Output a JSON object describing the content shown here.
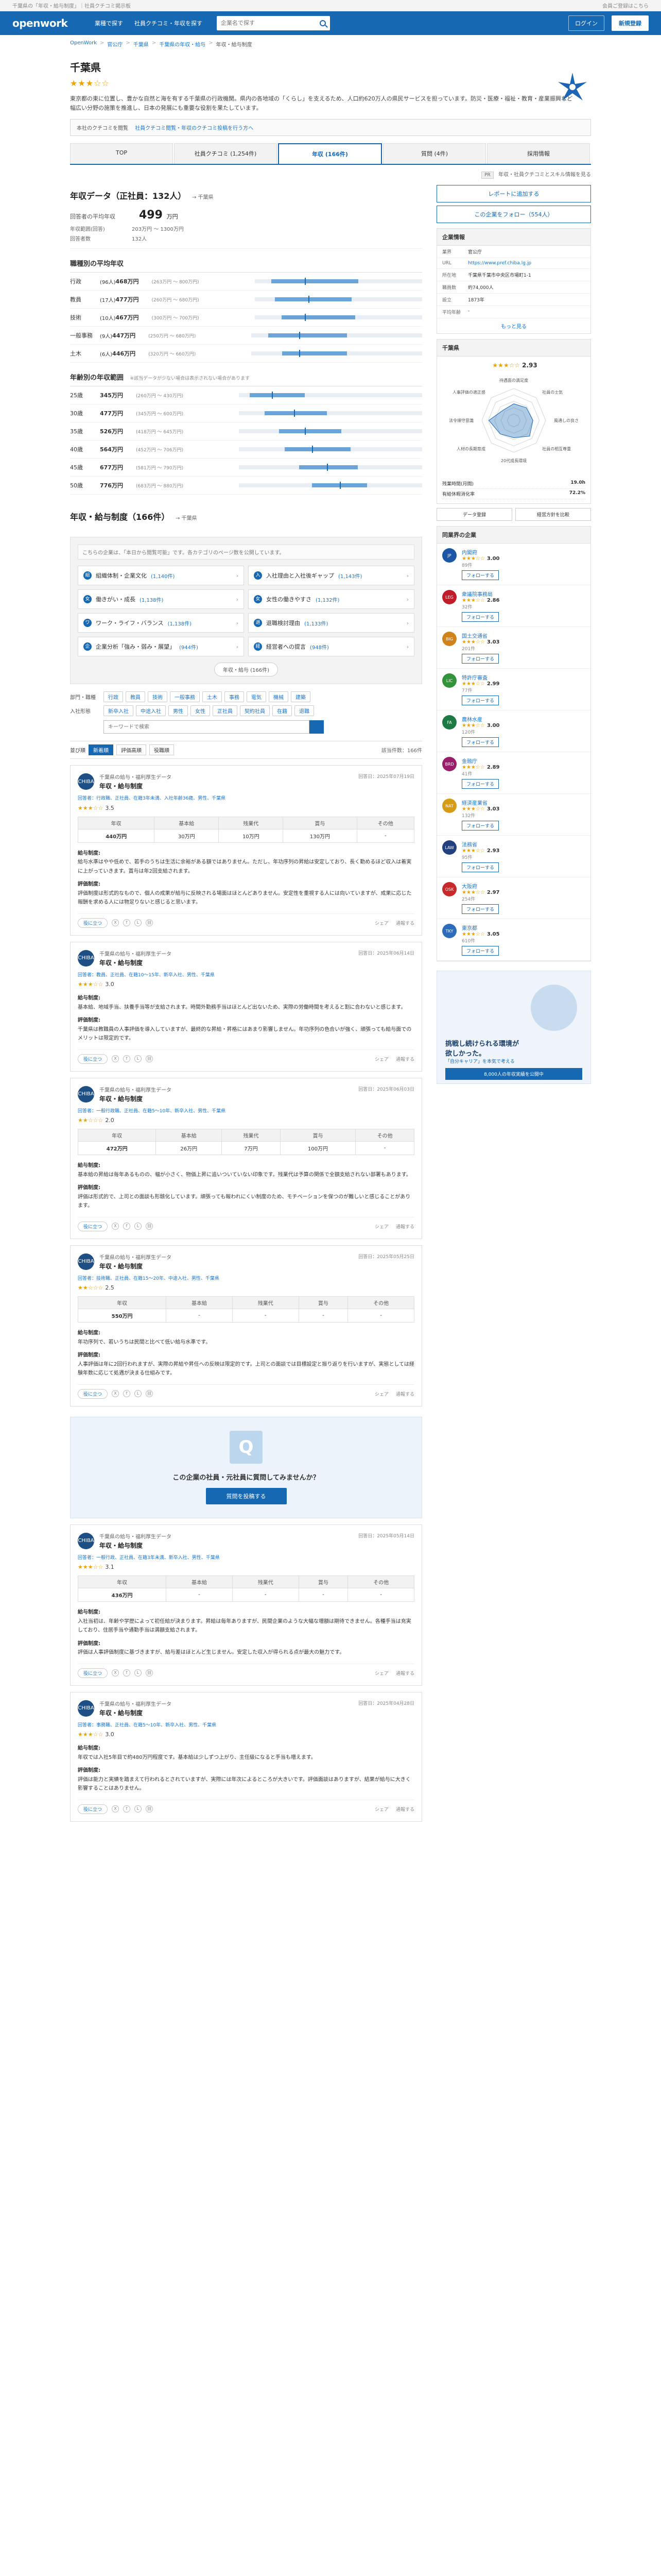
{
  "topbar": {
    "left": "千葉県の「年収・給与制度」｜社員クチコミ掲示板",
    "right": "会員ご登録はこちら"
  },
  "header": {
    "logo": "openwork",
    "nav": [
      "業種で探す",
      "社員クチコミ・年収を探す"
    ],
    "search_placeholder": "企業名で探す",
    "login": "ログイン",
    "register": "新規登録"
  },
  "breadcrumb": [
    "OpenWork",
    "官公庁",
    "千葉県",
    "千葉県の年収・給与",
    "年収・給与制度"
  ],
  "company": {
    "name": "千葉県",
    "stars": "★★★☆☆",
    "description": "東京都の東に位置し、豊かな自然と海を有する千葉県の行政機関。県内の各地域の「くらし」を支えるため、人口約620万人の県民サービスを担っています。防災・医療・福祉・教育・産業振興など幅広い分野の施策を推進し、日本の発展にも重要な役割を果たしています。",
    "notice_pre": "本社のクチコミを閲覧",
    "notice_link": "社員クチコミ閲覧・年収のクチコミ投稿を行う方へ"
  },
  "tabs": [
    {
      "label": "TOP"
    },
    {
      "label": "社員クチコミ (1,254件)"
    },
    {
      "label": "年収 (166件)"
    },
    {
      "label": "質問 (4件)"
    },
    {
      "label": "採用情報"
    }
  ],
  "subnote": {
    "tag": "PR",
    "text": "年収・社員クチコミとスキル情報を見る"
  },
  "salary": {
    "title": "年収データ（正社員：132人）",
    "title_note": "→ 千葉県",
    "avg_label": "回答者の平均年収",
    "avg_value": "499",
    "avg_unit": "万円",
    "meta": [
      {
        "k": "年収範囲(回答)",
        "v": "203万円 〜 1300万円"
      },
      {
        "k": "回答者数",
        "v": "132人"
      }
    ],
    "by_role_title": "職種別の平均年収",
    "by_role": [
      {
        "role": "行政",
        "sub": "(96人)",
        "amt": "468万円",
        "rng": "(263万円 〜 800万円)",
        "l": 10,
        "w": 52,
        "t": 30
      },
      {
        "role": "教員",
        "sub": "(17人)",
        "amt": "477万円",
        "rng": "(260万円 〜 680万円)",
        "l": 12,
        "w": 46,
        "t": 32
      },
      {
        "role": "技術",
        "sub": "(10人)",
        "amt": "467万円",
        "rng": "(300万円 〜 700万円)",
        "l": 16,
        "w": 44,
        "t": 30
      },
      {
        "role": "一般事務",
        "sub": "(9人)",
        "amt": "447万円",
        "rng": "(250万円 〜 680万円)",
        "l": 10,
        "w": 46,
        "t": 28
      },
      {
        "role": "土木",
        "sub": "(6人)",
        "amt": "446万円",
        "rng": "(320万円 〜 660万円)",
        "l": 18,
        "w": 38,
        "t": 28
      }
    ],
    "by_age_title": "年齢別の年収範囲",
    "by_age_note": "※該当データが少ない場合は表示されない場合があります",
    "by_age": [
      {
        "role": "25歳",
        "amt": "345万円",
        "rng": "(260万円 〜 430万円)",
        "l": 6,
        "w": 30,
        "t": 18
      },
      {
        "role": "30歳",
        "amt": "477万円",
        "rng": "(345万円 〜 600万円)",
        "l": 14,
        "w": 34,
        "t": 30
      },
      {
        "role": "35歳",
        "amt": "526万円",
        "rng": "(418万円 〜 645万円)",
        "l": 22,
        "w": 34,
        "t": 36
      },
      {
        "role": "40歳",
        "amt": "564万円",
        "rng": "(452万円 〜 706万円)",
        "l": 25,
        "w": 36,
        "t": 40
      },
      {
        "role": "45歳",
        "amt": "677万円",
        "rng": "(581万円 〜 790万円)",
        "l": 33,
        "w": 32,
        "t": 48
      },
      {
        "role": "50歳",
        "amt": "776万円",
        "rng": "(683万円 〜 880万円)",
        "l": 40,
        "w": 30,
        "t": 55
      }
    ]
  },
  "reviews_section": {
    "title": "年収・給与制度（166件）",
    "title_note": "→ 千葉県",
    "intro": "こちらの企業は、「本日から閲覧可能」です。各カテゴリのページ数を公開しています。",
    "topics": [
      {
        "icon": "組",
        "label": "組織体制・企業文化",
        "count": "(1,140件)"
      },
      {
        "icon": "入",
        "label": "入社理由と入社後ギャップ",
        "count": "(1,143件)"
      },
      {
        "icon": "女",
        "label": "働きがい・成長",
        "count": "(1,138件)"
      },
      {
        "icon": "女",
        "label": "女性の働きやすさ",
        "count": "(1,132件)"
      },
      {
        "icon": "ワ",
        "label": "ワーク・ライフ・バランス",
        "count": "(1,138件)"
      },
      {
        "icon": "退",
        "label": "退職検討理由",
        "count": "(1,133件)"
      },
      {
        "icon": "企",
        "label": "企業分析「強み・弱み・展望」",
        "count": "(944件)"
      },
      {
        "icon": "経",
        "label": "経営者への提言",
        "count": "(948件)"
      }
    ],
    "more": "年収・給与 (166件)",
    "filter_labels": [
      "部門・職種",
      "入社形態",
      "並び順"
    ],
    "dept_chips": [
      "行政",
      "教員",
      "技術",
      "一般事務",
      "土木",
      "事務",
      "電気",
      "機械",
      "建築"
    ],
    "join_chips": [
      "新卒入社",
      "中途入社",
      "男性",
      "女性",
      "正社員",
      "契約社員",
      "在籍",
      "退職"
    ],
    "keyword_placeholder": "キーワードで検索",
    "sort": [
      "新着順",
      "評価高順",
      "役職順"
    ],
    "count_text": "該当件数：166件"
  },
  "reviews": [
    {
      "avatar": "CHIBA",
      "category": "千葉県の給与・福利厚生データ",
      "heading": "年収・給与制度",
      "date": "回答日：2025年07月19日",
      "who": "回答者：行政職、正社員、在籍3年未満、入社年齢36歳、男性、千葉県",
      "rating": "★★★☆☆",
      "score": "3.5",
      "cols": [
        "年収",
        "基本給",
        "残業代",
        "賞与",
        "その他"
      ],
      "vals": [
        "440万円",
        "30万円",
        "10万円",
        "130万円",
        "-"
      ],
      "body": [
        "給与制度:",
        "給与水準はやや低めで、若手のうちは生活に余裕がある額ではありません。ただし、年功序列の昇給は安定しており、長く勤めるほど収入は着実に上がっていきます。賞与は年2回支給されます。",
        "評価制度:",
        "評価制度は形式的なもので、個人の成果が給与に反映される場面はほとんどありません。安定性を重視する人には向いていますが、成果に応じた報酬を求める人には物足りないと感じると思います。"
      ]
    },
    {
      "avatar": "CHIBA",
      "category": "千葉県の給与・福利厚生データ",
      "heading": "年収・給与制度",
      "date": "回答日：2025年06月14日",
      "who": "回答者：教員、正社員、在籍10〜15年、新卒入社、男性、千葉県",
      "rating": "★★★☆☆",
      "score": "3.0",
      "cols": [],
      "vals": [],
      "body": [
        "給与制度:",
        "基本給、地域手当、扶養手当等が支給されます。時間外勤務手当はほとんど出ないため、実際の労働時間を考えると割に合わないと感じます。",
        "評価制度:",
        "千葉県は教職員の人事評価を導入していますが、最終的な昇給・昇格にはあまり影響しません。年功序列の色合いが強く、頑張っても給与面でのメリットは限定的です。"
      ]
    },
    {
      "avatar": "CHIBA",
      "category": "千葉県の給与・福利厚生データ",
      "heading": "年収・給与制度",
      "date": "回答日：2025年06月03日",
      "who": "回答者：一般行政職、正社員、在籍5〜10年、新卒入社、男性、千葉県",
      "rating": "★★☆☆☆",
      "score": "2.0",
      "cols": [
        "年収",
        "基本給",
        "残業代",
        "賞与",
        "その他"
      ],
      "vals": [
        "472万円",
        "26万円",
        "7万円",
        "100万円",
        "-"
      ],
      "body": [
        "給与制度:",
        "基本給の昇給は毎年あるものの、幅が小さく、物価上昇に追いついていない印象です。残業代は予算の関係で全額支給されない部署もあります。",
        "評価制度:",
        "評価は形式的で、上司との面談も形骸化しています。頑張っても報われにくい制度のため、モチベーションを保つのが難しいと感じることがあります。"
      ]
    },
    {
      "avatar": "CHIBA",
      "category": "千葉県の給与・福利厚生データ",
      "heading": "年収・給与制度",
      "date": "回答日：2025年05月25日",
      "who": "回答者：技術職、正社員、在籍15〜20年、中途入社、男性、千葉県",
      "rating": "★★☆☆☆",
      "score": "2.5",
      "cols": [
        "年収",
        "基本給",
        "残業代",
        "賞与",
        "その他"
      ],
      "vals": [
        "550万円",
        "-",
        "-",
        "-",
        "-"
      ],
      "body": [
        "給与制度:",
        "年功序列で、若いうちは民間と比べて低い給与水準です。",
        "評価制度:",
        "人事評価は年に2回行われますが、実際の昇給や昇任への反映は限定的です。上司との面談では目標設定と振り返りを行いますが、実態としては経験年数に応じて処遇が決まる仕組みです。"
      ]
    },
    {
      "avatar": "CHIBA",
      "category": "千葉県の給与・福利厚生データ",
      "heading": "年収・給与制度",
      "date": "回答日：2025年05月14日",
      "who": "回答者：一般行政、正社員、在籍3年未満、新卒入社、男性、千葉県",
      "rating": "★★★☆☆",
      "score": "3.1",
      "cols": [
        "年収",
        "基本給",
        "残業代",
        "賞与",
        "その他"
      ],
      "vals": [
        "436万円",
        "-",
        "-",
        "-",
        "-"
      ],
      "body": [
        "給与制度:",
        "入社当初は、年齢や学歴によって初任給が決まります。昇給は毎年ありますが、民間企業のような大幅な増額は期待できません。各種手当は充実しており、住居手当や通勤手当は満額支給されます。",
        "評価制度:",
        "評価は人事評価制度に基づきますが、給与差はほとんど生じません。安定した収入が得られる点が最大の魅力です。"
      ]
    },
    {
      "avatar": "CHIBA",
      "category": "千葉県の給与・福利厚生データ",
      "heading": "年収・給与制度",
      "date": "回答日：2025年04月28日",
      "who": "回答者：事務職、正社員、在籍5〜10年、新卒入社、男性、千葉県",
      "rating": "★★★☆☆",
      "score": "3.0",
      "cols": [],
      "vals": [],
      "body": [
        "給与制度:",
        "年収では入社5年目で約480万円程度です。基本給は少しずつ上がり、主任級になると手当も増えます。",
        "評価制度:",
        "評価は能力と実績を踏まえて行われるとされていますが、実際には年次によるところが大きいです。評価面談はありますが、結果が給与に大きく影響することはありません。"
      ]
    }
  ],
  "review_actions": {
    "helpful": "役に立つ",
    "report": "通報する",
    "share": "シェア"
  },
  "cta": {
    "title": "この企業の社員・元社員に質問してみませんか？",
    "button": "質問を投稿する"
  },
  "sidebar": {
    "btn1": "レポートに追加する",
    "btn2": "この企業をフォロー（554人）",
    "info_title": "企業情報",
    "info": [
      {
        "k": "業界",
        "v": "官公庁"
      },
      {
        "k": "URL",
        "v": "https://www.pref.chiba.lg.jp"
      },
      {
        "k": "所在地",
        "v": "千葉県千葉市中央区市場町1-1"
      },
      {
        "k": "職員数",
        "v": "約74,000人"
      },
      {
        "k": "設立",
        "v": "1873年"
      },
      {
        "k": "平均年齢",
        "v": "-"
      }
    ],
    "info_more": "もっと見る",
    "radar_title": "千葉県",
    "radar_stars": "★★★☆☆",
    "radar_score": "2.93",
    "radar_axes": [
      "待遇面の満足度",
      "社員の士気",
      "風通しの良さ",
      "社員の相互尊重",
      "20代成長環境",
      "人材の長期育成",
      "法令順守意識",
      "人事評価の適正感"
    ],
    "radar_values": [
      2.6,
      2.8,
      3.0,
      3.5,
      2.7,
      3.0,
      3.9,
      2.3
    ],
    "mini": [
      {
        "k": "残業時間(月間)",
        "v": "19.0h"
      },
      {
        "k": "有給休暇消化率",
        "v": "72.2%"
      }
    ],
    "pair": [
      "データ登録",
      "経営方針を比較"
    ],
    "compare_title": "同業界の企業",
    "companies": [
      {
        "logo": "JP",
        "color": "#1c57a5",
        "name": "内閣府",
        "stars": "★★★☆☆",
        "score": "3.00",
        "count": "89件"
      },
      {
        "logo": "LEG",
        "color": "#c01c2a",
        "name": "衆議院事務局",
        "stars": "★★★☆☆",
        "score": "2.86",
        "count": "32件"
      },
      {
        "logo": "BIG",
        "color": "#d0831a",
        "name": "国土交通省",
        "stars": "★★★☆☆",
        "score": "3.03",
        "count": "201件"
      },
      {
        "logo": "LIC",
        "color": "#31943b",
        "name": "特許庁審査",
        "stars": "★★★☆☆",
        "score": "2.99",
        "count": "77件"
      },
      {
        "logo": "FA",
        "color": "#1e7a43",
        "name": "農林水産",
        "stars": "★★★☆☆",
        "score": "3.00",
        "count": "120件"
      },
      {
        "logo": "BRD",
        "color": "#9a1d6b",
        "name": "金融庁",
        "stars": "★★★☆☆",
        "score": "2.89",
        "count": "41件"
      },
      {
        "logo": "NAT",
        "color": "#d59c14",
        "name": "経済産業省",
        "stars": "★★★☆☆",
        "score": "3.03",
        "count": "132件"
      },
      {
        "logo": "LAW",
        "color": "#23407e",
        "name": "法務省",
        "stars": "★★★☆☆",
        "score": "2.93",
        "count": "95件"
      },
      {
        "logo": "OSK",
        "color": "#c62a2a",
        "name": "大阪府",
        "stars": "★★★☆☆",
        "score": "2.97",
        "count": "254件"
      },
      {
        "logo": "TKY",
        "color": "#2c6cbb",
        "name": "東京都",
        "stars": "★★★☆☆",
        "score": "3.05",
        "count": "610件"
      }
    ],
    "follow": "フォローする",
    "ad_line1": "挑戦し続けられる環境が",
    "ad_line1b": "欲しかった。",
    "ad_line2": "「自分キャリア」を本気で考える",
    "ad_line3": "8,000人の年収実績を公開中"
  }
}
